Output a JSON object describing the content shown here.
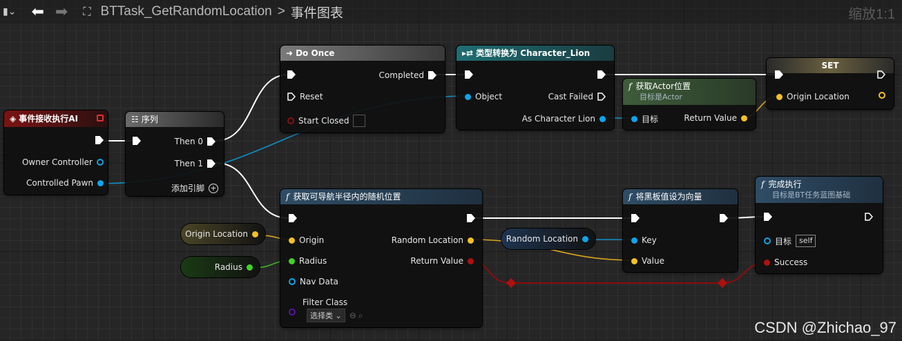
{
  "toolbar": {
    "breadcrumb_task": "BTTask_GetRandomLocation",
    "breadcrumb_sep": ">",
    "breadcrumb_graph": "事件图表",
    "zoom": "缩放1:1"
  },
  "nodes": {
    "event": {
      "title": "事件接收执行AI",
      "owner": "Owner Controller",
      "pawn": "Controlled Pawn"
    },
    "sequence": {
      "title": "序列",
      "then0": "Then 0",
      "then1": "Then 1",
      "add_pin": "添加引脚"
    },
    "doonce": {
      "title": "Do Once",
      "completed": "Completed",
      "reset": "Reset",
      "start_closed": "Start Closed"
    },
    "cast": {
      "title": "类型转换为 Character_Lion",
      "object": "Object",
      "cast_failed": "Cast Failed",
      "as": "As Character Lion"
    },
    "getloc": {
      "title": "获取Actor位置",
      "subtitle": "目标是Actor",
      "target": "目标",
      "return": "Return Value"
    },
    "set": {
      "title": "SET",
      "origin": "Origin Location"
    },
    "random": {
      "title": "获取可导航半径内的随机位置",
      "origin": "Origin",
      "radius": "Radius",
      "navdata": "Nav Data",
      "filter": "Filter Class",
      "filter_value": "选择类",
      "random_loc": "Random Location",
      "return": "Return Value"
    },
    "blackboard": {
      "title": "将黑板值设为向量",
      "key": "Key",
      "value": "Value"
    },
    "finish": {
      "title": "完成执行",
      "subtitle": "目标是BT任务蓝图基础",
      "target": "目标",
      "target_value": "self",
      "success": "Success"
    }
  },
  "vars": {
    "origin": "Origin Location",
    "radius": "Radius",
    "random": "Random Location"
  },
  "colors": {
    "exec": "#ffffff",
    "object": "#0ea5e9",
    "vector": "#f5c024",
    "float": "#3fd424",
    "bool": "#8c0d0d",
    "class": "#5a13a5",
    "event_header": "#7a1414",
    "cast_header": "#1f6e73",
    "func_header": "#2f4d66",
    "pure_header": "#3e5c3a"
  },
  "watermark": "CSDN @Zhichao_97"
}
